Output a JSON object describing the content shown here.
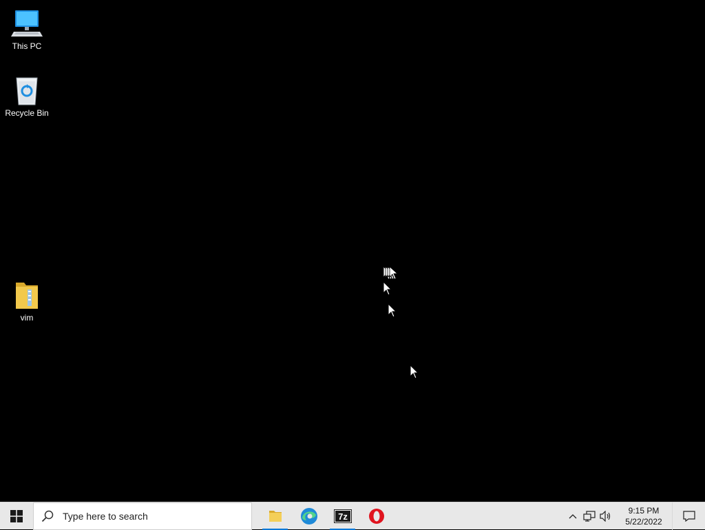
{
  "desktop": {
    "icons": [
      {
        "label": "This PC",
        "icon": "this-pc-icon"
      },
      {
        "label": "Recycle Bin",
        "icon": "recycle-bin-icon"
      },
      {
        "label": "vim",
        "icon": "folder-icon"
      }
    ]
  },
  "taskbar": {
    "search": {
      "placeholder": "Type here to search"
    },
    "pinned": [
      {
        "name": "File Explorer",
        "icon": "file-explorer-icon",
        "running": true
      },
      {
        "name": "Microsoft Edge",
        "icon": "edge-icon",
        "running": false
      },
      {
        "name": "7-Zip",
        "icon": "7zip-icon",
        "running": true
      },
      {
        "name": "Opera",
        "icon": "opera-icon",
        "running": false
      }
    ],
    "tray": {
      "time": "9:15 PM",
      "date": "5/22/2022"
    }
  },
  "colors": {
    "desktop_bg": "#000000",
    "taskbar_bg": "#e8e8e8",
    "accent": "#0078d7"
  }
}
